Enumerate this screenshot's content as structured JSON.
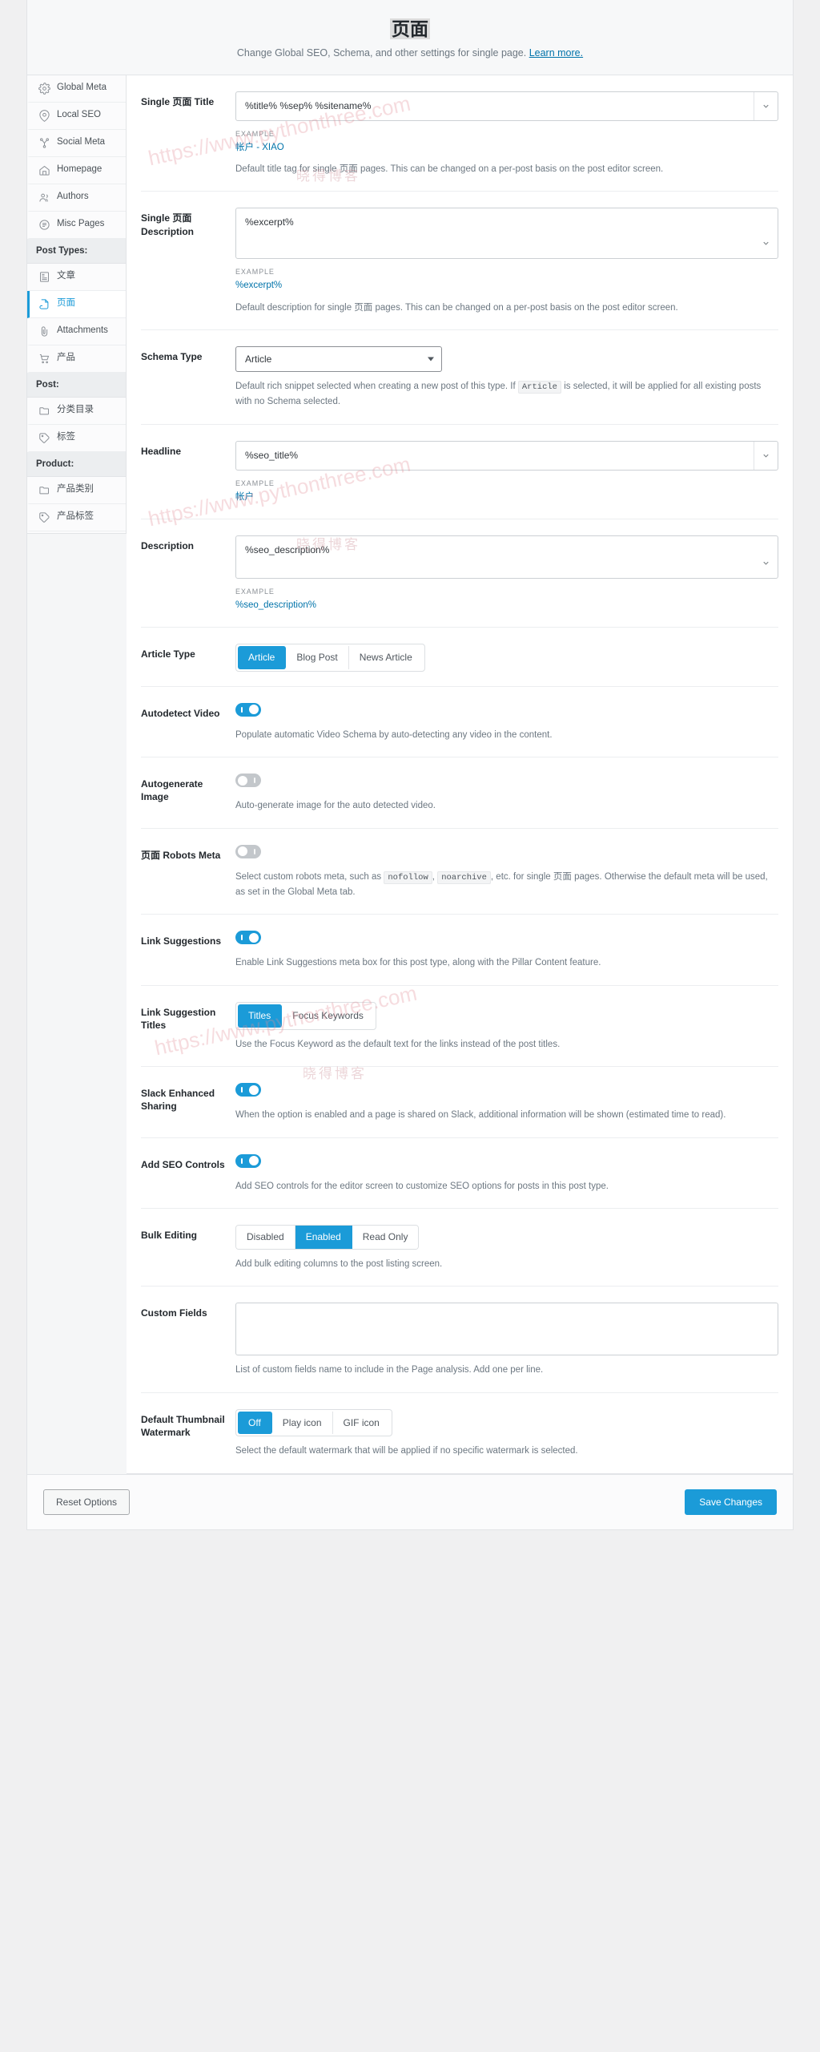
{
  "header": {
    "title": "页面",
    "subtitle": "Change Global SEO, Schema, and other settings for single page.",
    "learn_more": "Learn more."
  },
  "sidebar": {
    "items": [
      {
        "label": "Global Meta",
        "icon": "gear-icon",
        "type": "item",
        "active": false
      },
      {
        "label": "Local SEO",
        "icon": "location-pin-icon",
        "type": "item",
        "active": false
      },
      {
        "label": "Social Meta",
        "icon": "share-nodes-icon",
        "type": "item",
        "active": false
      },
      {
        "label": "Homepage",
        "icon": "home-icon",
        "type": "item",
        "active": false
      },
      {
        "label": "Authors",
        "icon": "users-icon",
        "type": "item",
        "active": false
      },
      {
        "label": "Misc Pages",
        "icon": "list-circle-icon",
        "type": "item",
        "active": false
      },
      {
        "label": "Post Types:",
        "icon": "",
        "type": "group",
        "active": false
      },
      {
        "label": "文章",
        "icon": "article-icon",
        "type": "item",
        "active": false
      },
      {
        "label": "页面",
        "icon": "page-icon",
        "type": "item",
        "active": true
      },
      {
        "label": "Attachments",
        "icon": "paperclip-icon",
        "type": "item",
        "active": false
      },
      {
        "label": "产品",
        "icon": "cart-icon",
        "type": "item",
        "active": false
      },
      {
        "label": "Post:",
        "icon": "",
        "type": "group",
        "active": false
      },
      {
        "label": "分类目录",
        "icon": "folder-icon",
        "type": "item",
        "active": false
      },
      {
        "label": "标签",
        "icon": "tag-icon",
        "type": "item",
        "active": false
      },
      {
        "label": "Product:",
        "icon": "",
        "type": "group",
        "active": false
      },
      {
        "label": "产品类别",
        "icon": "folder-icon",
        "type": "item",
        "active": false
      },
      {
        "label": "产品标签",
        "icon": "tag-icon",
        "type": "item",
        "active": false
      }
    ]
  },
  "fields": {
    "single_title": {
      "label": "Single 页面 Title",
      "value": "%title% %sep% %sitename%",
      "example_label": "EXAMPLE",
      "example_value": "帐户 - XIAO",
      "desc": "Default title tag for single 页面 pages. This can be changed on a per-post basis on the post editor screen."
    },
    "single_description": {
      "label": "Single 页面 Description",
      "value": "%excerpt%",
      "example_label": "EXAMPLE",
      "example_value": "%excerpt%",
      "desc": "Default description for single 页面 pages. This can be changed on a per-post basis on the post editor screen."
    },
    "schema_type": {
      "label": "Schema Type",
      "value": "Article",
      "options": [
        "Article"
      ],
      "desc_part1": "Default rich snippet selected when creating a new post of this type. If",
      "desc_code": "Article",
      "desc_part2": "is selected, it will be applied for all existing posts with no Schema selected."
    },
    "headline": {
      "label": "Headline",
      "value": "%seo_title%",
      "example_label": "EXAMPLE",
      "example_value": "帐户"
    },
    "description": {
      "label": "Description",
      "value": "%seo_description%",
      "example_label": "EXAMPLE",
      "example_value": "%seo_description%"
    },
    "article_type": {
      "label": "Article Type",
      "options": [
        "Article",
        "Blog Post",
        "News Article"
      ],
      "selected": "Article"
    },
    "autodetect_video": {
      "label": "Autodetect Video",
      "state": "on",
      "desc": "Populate automatic Video Schema by auto-detecting any video in the content."
    },
    "autogenerate_image": {
      "label": "Autogenerate Image",
      "state": "off",
      "desc": "Auto-generate image for the auto detected video."
    },
    "robots_meta": {
      "label": "页面 Robots Meta",
      "state": "off",
      "desc_part1": "Select custom robots meta, such as",
      "desc_code1": "nofollow",
      "desc_mid": ",",
      "desc_code2": "noarchive",
      "desc_part2": ", etc. for single 页面 pages. Otherwise the default meta will be used, as set in the Global Meta tab."
    },
    "link_suggestions": {
      "label": "Link Suggestions",
      "state": "on",
      "desc": "Enable Link Suggestions meta box for this post type, along with the Pillar Content feature."
    },
    "link_suggestion_titles": {
      "label": "Link Suggestion Titles",
      "options": [
        "Titles",
        "Focus Keywords"
      ],
      "selected": "Titles",
      "desc": "Use the Focus Keyword as the default text for the links instead of the post titles."
    },
    "slack_sharing": {
      "label": "Slack Enhanced Sharing",
      "state": "on",
      "desc": "When the option is enabled and a page is shared on Slack, additional information will be shown (estimated time to read)."
    },
    "seo_controls": {
      "label": "Add SEO Controls",
      "state": "on",
      "desc": "Add SEO controls for the editor screen to customize SEO options for posts in this post type."
    },
    "bulk_editing": {
      "label": "Bulk Editing",
      "options": [
        "Disabled",
        "Enabled",
        "Read Only"
      ],
      "selected": "Enabled",
      "desc": "Add bulk editing columns to the post listing screen."
    },
    "custom_fields": {
      "label": "Custom Fields",
      "value": "",
      "desc": "List of custom fields name to include in the Page analysis. Add one per line."
    },
    "thumbnail_watermark": {
      "label": "Default Thumbnail Watermark",
      "options": [
        "Off",
        "Play icon",
        "GIF icon"
      ],
      "selected": "Off",
      "desc": "Select the default watermark that will be applied if no specific watermark is selected."
    }
  },
  "footer": {
    "reset_label": "Reset Options",
    "save_label": "Save Changes"
  },
  "watermarks": {
    "url1": "https://www.pythonthree.com",
    "url2": "https://www.pythonthree.com",
    "url3": "https://www.pythonthree.com",
    "cn1": "晓得博客",
    "cn2": "晓得博客",
    "cn3": "晓得博客"
  },
  "colors": {
    "accent": "#1b9bd8",
    "link": "#0073aa",
    "toggle_off": "#c3c7cb"
  }
}
